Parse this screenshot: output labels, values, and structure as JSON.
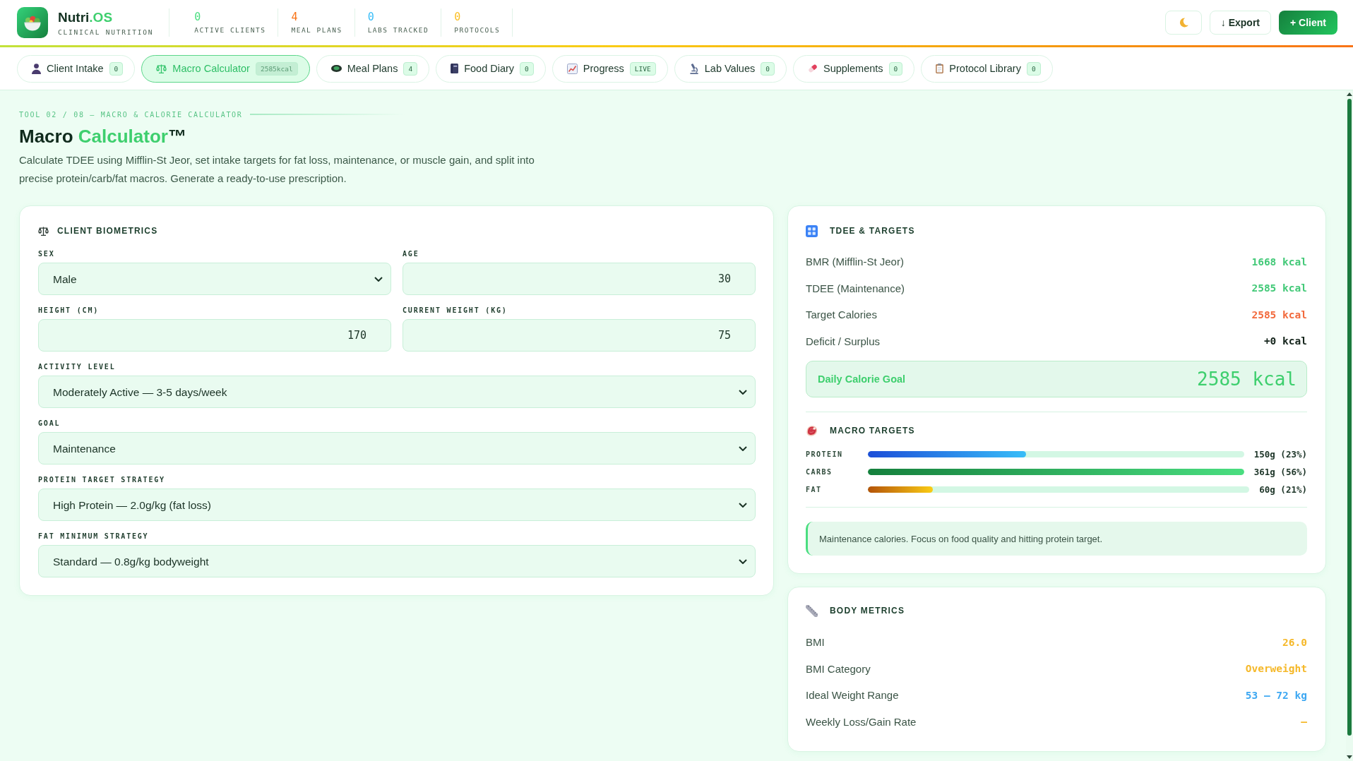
{
  "header": {
    "brand": {
      "parts": [
        {
          "text": "Nutri",
          "accent": false
        },
        {
          "text": ".OS",
          "accent": true
        }
      ],
      "subtitle": "CLINICAL NUTRITION"
    },
    "stats": [
      {
        "value": "0",
        "label": "ACTIVE CLIENTS",
        "color": "#4ade80"
      },
      {
        "value": "4",
        "label": "MEAL PLANS",
        "color": "#f97316"
      },
      {
        "value": "0",
        "label": "LABS TRACKED",
        "color": "#38bdf8"
      },
      {
        "value": "0",
        "label": "PROTOCOLS",
        "color": "#fbbf24"
      }
    ],
    "buttons": [
      {
        "kind": "icon"
      },
      {
        "kind": "outline",
        "label": "↓ Export"
      },
      {
        "kind": "primary",
        "label": "+ Client"
      }
    ]
  },
  "tabs": [
    {
      "label": "Client Intake",
      "badge": "0",
      "selected": false
    },
    {
      "label": "Macro Calculator",
      "badge": "2585kcal",
      "selected": true
    },
    {
      "label": "Meal Plans",
      "badge": "4",
      "selected": false
    },
    {
      "label": "Food Diary",
      "badge": "0",
      "selected": false
    },
    {
      "label": "Progress",
      "badge": "LIVE",
      "selected": false
    },
    {
      "label": "Lab Values",
      "badge": "0",
      "selected": false
    },
    {
      "label": "Supplements",
      "badge": "0",
      "selected": false
    },
    {
      "label": "Protocol Library",
      "badge": "0",
      "selected": false
    }
  ],
  "breadcrumb": "TOOL 02 / 08 — MACRO & CALORIE CALCULATOR",
  "title": [
    {
      "text": "Macro ",
      "accent": false
    },
    {
      "text": "Calculator",
      "accent": true
    },
    {
      "text": "™",
      "accent": false
    }
  ],
  "description": "Calculate TDEE using Mifflin-St Jeor, set intake targets for fat loss, maintenance, or muscle gain, and split into precise protein/carb/fat macros. Generate a ready-to-use prescription.",
  "biometrics": {
    "title": "CLIENT BIOMETRICS",
    "rows": [
      {
        "fields": [
          {
            "label": "SEX",
            "kind": "select",
            "value": "Male"
          },
          {
            "label": "AGE",
            "kind": "number",
            "value": "30"
          }
        ]
      },
      {
        "fields": [
          {
            "label": "HEIGHT (CM)",
            "kind": "number",
            "value": "170"
          },
          {
            "label": "CURRENT WEIGHT (KG)",
            "kind": "number",
            "value": "75"
          }
        ]
      },
      {
        "fields": [
          {
            "label": "ACTIVITY LEVEL",
            "kind": "select",
            "value": "Moderately Active — 3-5 days/week"
          }
        ]
      },
      {
        "fields": [
          {
            "label": "GOAL",
            "kind": "select",
            "value": "Maintenance"
          }
        ]
      },
      {
        "fields": [
          {
            "label": "PROTEIN TARGET STRATEGY",
            "kind": "select",
            "value": "High Protein — 2.0g/kg (fat loss)"
          }
        ]
      },
      {
        "fields": [
          {
            "label": "FAT MINIMUM STRATEGY",
            "kind": "select",
            "value": "Standard — 0.8g/kg bodyweight"
          }
        ]
      }
    ]
  },
  "tdee": {
    "title": "TDEE & TARGETS",
    "rows": [
      {
        "label": "BMR (Mifflin-St Jeor)",
        "value": "1668 kcal",
        "color": "#43c978"
      },
      {
        "label": "TDEE (Maintenance)",
        "value": "2585 kcal",
        "color": "#43c978"
      },
      {
        "label": "Target Calories",
        "value": "2585 kcal",
        "color": "#f26a3d"
      },
      {
        "label": "Deficit / Surplus",
        "value": "+0 kcal",
        "color": "#14241b"
      }
    ],
    "goal": {
      "label": "Daily Calorie Goal",
      "value": "2585 kcal"
    }
  },
  "macros": {
    "title": "MACRO TARGETS",
    "rows": [
      {
        "label": "PROTEIN",
        "level": 0.42,
        "reading": "150g (23%)"
      },
      {
        "label": "CARBS",
        "level": 1,
        "reading": "361g (56%)"
      },
      {
        "label": "FAT",
        "level": 0.17,
        "reading": "60g (21%)"
      }
    ],
    "note": "Maintenance calories. Focus on food quality and hitting protein target."
  },
  "body_metrics": {
    "title": "BODY METRICS",
    "rows": [
      {
        "label": "BMI",
        "value": "26.0",
        "color": "#f5b829"
      },
      {
        "label": "BMI Category",
        "value": "Overweight",
        "color": "#f5b829"
      },
      {
        "label": "Ideal Weight Range",
        "value": "53 – 72 kg",
        "color": "#3ea8f2"
      },
      {
        "label": "Weekly Loss/Gain Rate",
        "value": "—",
        "color": "#f5b829"
      }
    ]
  }
}
